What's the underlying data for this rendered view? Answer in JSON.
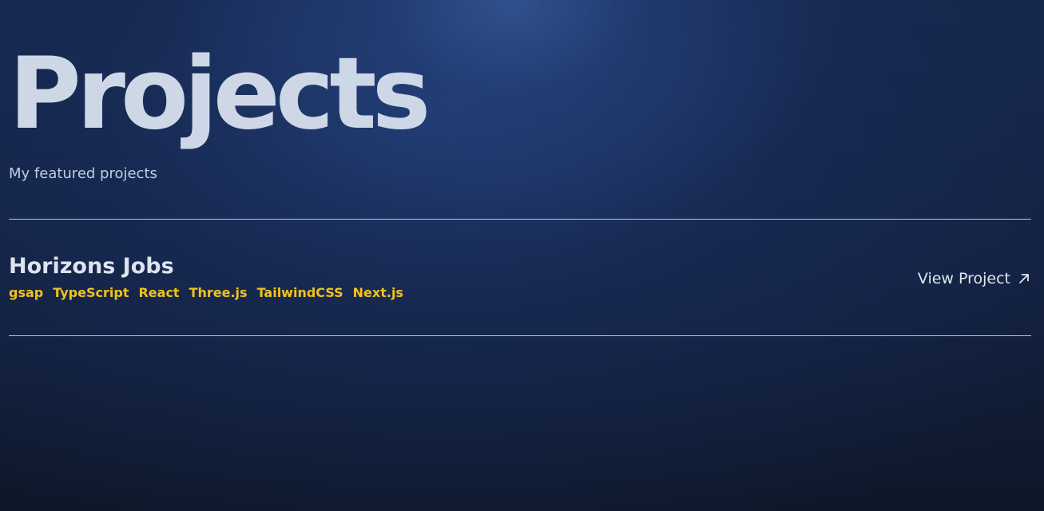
{
  "header": {
    "title": "Projects",
    "subtitle": "My featured projects"
  },
  "projects": [
    {
      "title": "Horizons Jobs",
      "tags": [
        "gsap",
        "TypeScript",
        "React",
        "Three.js",
        "TailwindCSS",
        "Next.js"
      ],
      "link_label": "View Project",
      "link_icon": "arrow-up-right-icon"
    }
  ],
  "colors": {
    "background": "#15284c",
    "title": "#cdd7e6",
    "tag": "#f2c21b",
    "divider": "#dce4f0"
  }
}
